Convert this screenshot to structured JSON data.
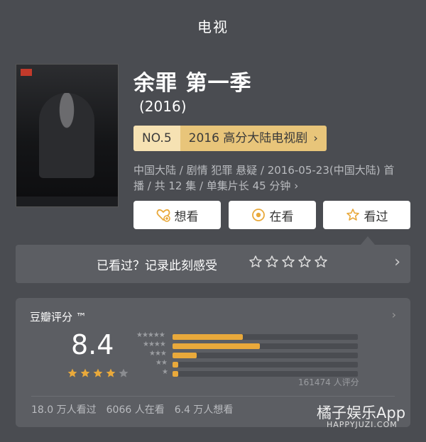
{
  "header": {
    "title": "电视"
  },
  "show": {
    "title": "余罪 第一季",
    "year": "(2016)",
    "rank_no": "NO.5",
    "rank_label": "2016 高分大陆电视剧",
    "meta_line1": "中国大陆 / 剧情 犯罪 悬疑 / 2016-05-23(中国大陆) 首",
    "meta_line2": "播 / 共 12 集 / 单集片长 45 分钟"
  },
  "actions": {
    "want": "想看",
    "watching": "在看",
    "watched": "看过"
  },
  "seen_prompt": {
    "text": "已看过？记录此刻感受"
  },
  "rating": {
    "header": "豆瓣评分 ™",
    "score": "8.4",
    "stars_filled": 4,
    "stars_total": 5,
    "distribution": [
      {
        "label": "★★★★★",
        "fraction": 0.38
      },
      {
        "label": "★★★★",
        "fraction": 0.47
      },
      {
        "label": "★★★",
        "fraction": 0.13
      },
      {
        "label": "★★",
        "fraction": 0.03
      },
      {
        "label": "★",
        "fraction": 0.03
      }
    ],
    "count": "161474 人评分"
  },
  "stats": {
    "watched": "18.0 万人看过",
    "watching": "6066 人在看",
    "want": "6.4 万人想看"
  },
  "watermark": {
    "brand": "橘子娱乐App",
    "url": "HAPPYJUZI.COM"
  },
  "colors": {
    "accent": "#e9a93b",
    "rank_bg": "#e8c57a",
    "card_bg": "#5c5e63",
    "page_bg": "#4a4c51"
  }
}
